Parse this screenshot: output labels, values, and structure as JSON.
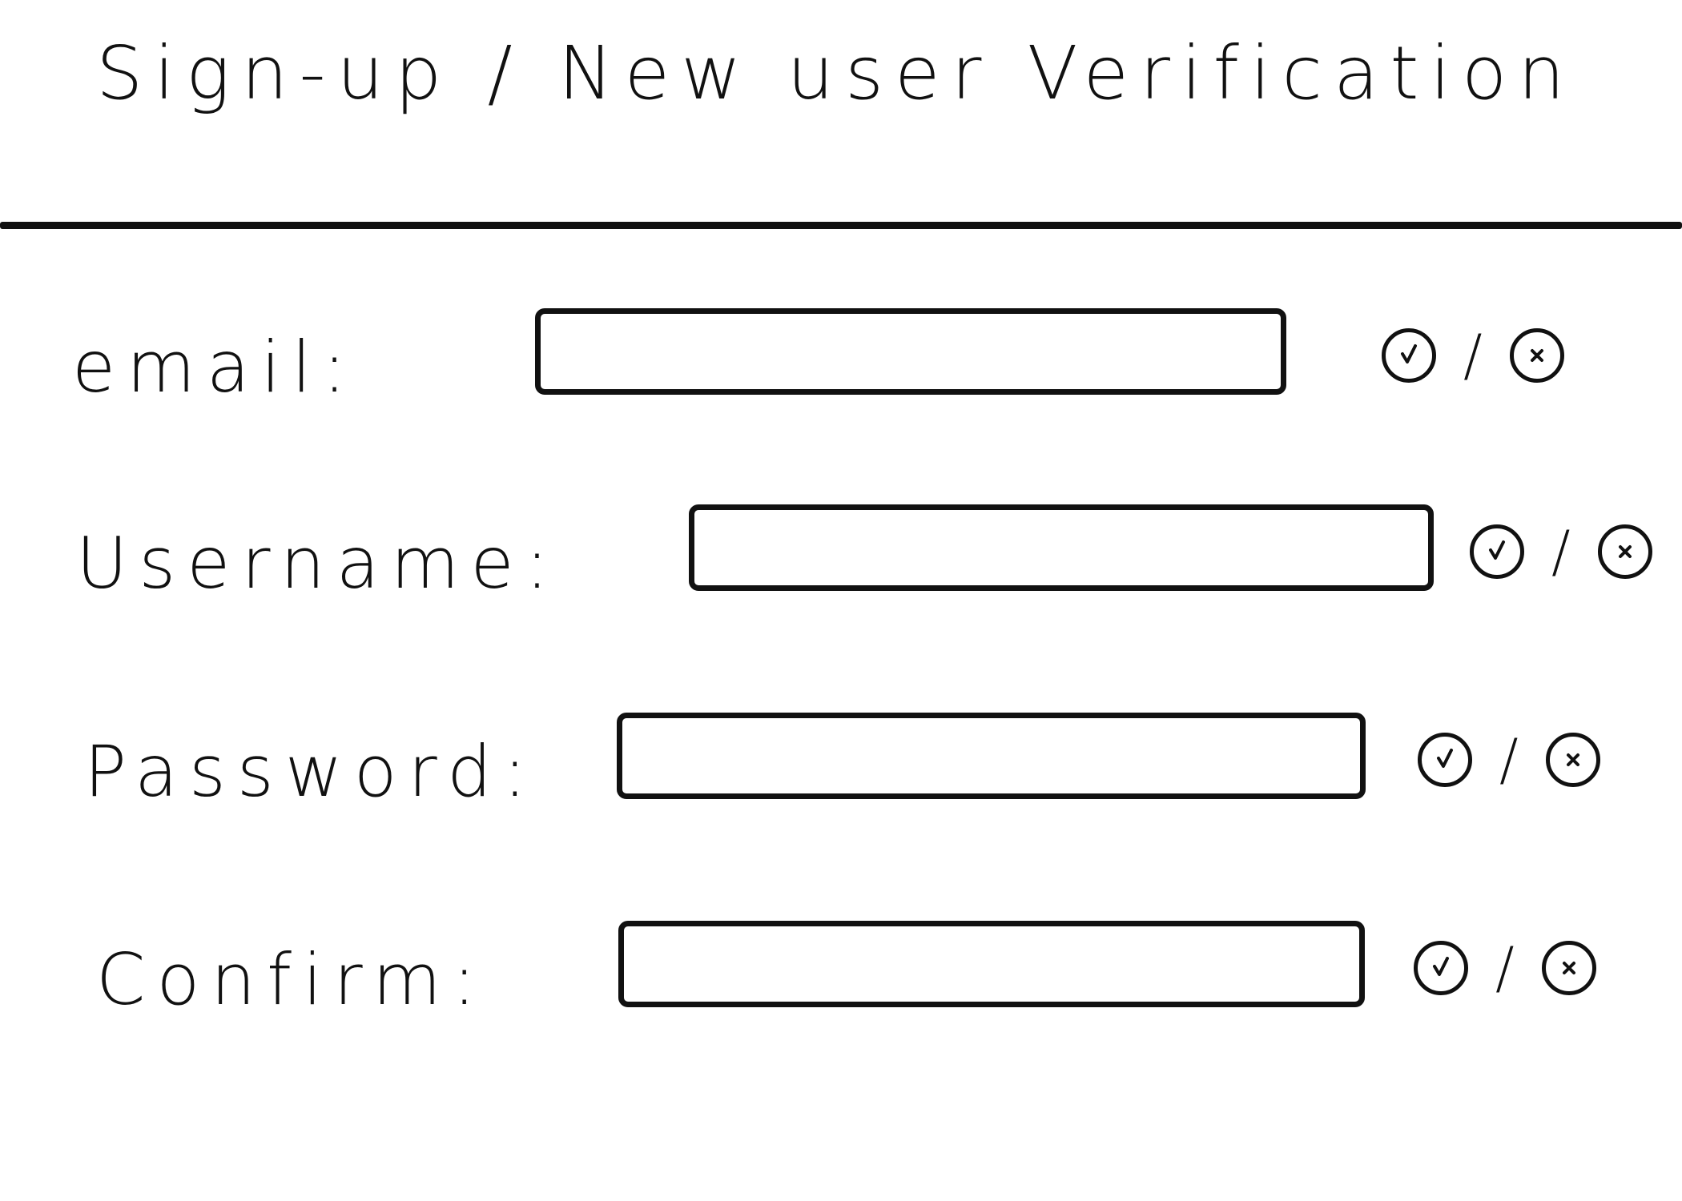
{
  "header": {
    "title": "Sign-up / New user Verification"
  },
  "form": {
    "fields": [
      {
        "label": "email:",
        "value": "",
        "placeholder": "",
        "status_valid_icon": "check-circle-icon",
        "status_separator": "/",
        "status_invalid_icon": "x-circle-icon"
      },
      {
        "label": "Username:",
        "value": "",
        "placeholder": "",
        "status_valid_icon": "check-circle-icon",
        "status_separator": "/",
        "status_invalid_icon": "x-circle-icon"
      },
      {
        "label": "Password:",
        "value": "",
        "placeholder": "",
        "status_valid_icon": "check-circle-icon",
        "status_separator": "/",
        "status_invalid_icon": "x-circle-icon"
      },
      {
        "label": "Confirm:",
        "value": "",
        "placeholder": "",
        "status_valid_icon": "check-circle-icon",
        "status_separator": "/",
        "status_invalid_icon": "x-circle-icon"
      }
    ]
  },
  "colors": {
    "ink": "#111111",
    "background": "#ffffff"
  }
}
